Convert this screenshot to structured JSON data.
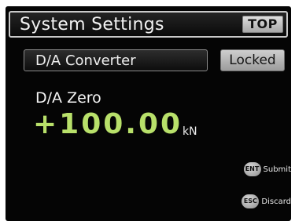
{
  "header": {
    "title": "System Settings",
    "top_button": "TOP"
  },
  "setting": {
    "item_label": "D/A Converter",
    "status": "Locked",
    "param_name": "D/A Zero",
    "value": "+100.00",
    "unit": "kN"
  },
  "keys": {
    "submit": {
      "key": "ENT",
      "label": "Submit"
    },
    "discard": {
      "key": "ESC",
      "label": "Discard"
    }
  },
  "colors": {
    "background": "#050505",
    "value_green": "#b8e06a",
    "button_gray": "#c4c4c4"
  }
}
